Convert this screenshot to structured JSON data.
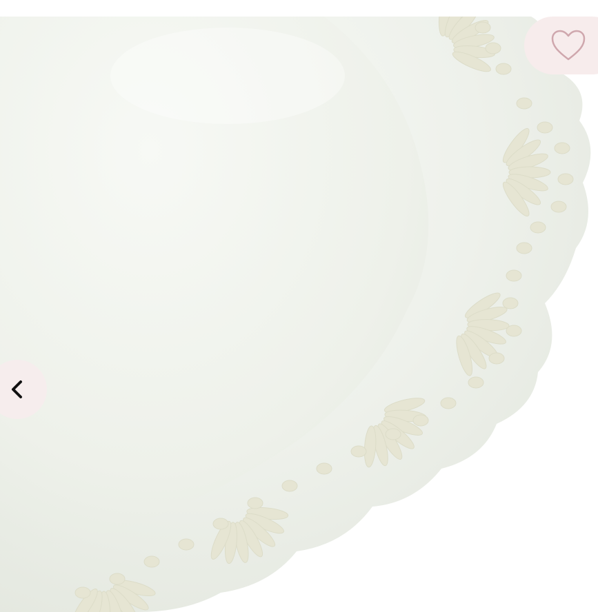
{
  "gallery": {
    "favorite": {
      "icon": "heart-outline-icon",
      "count_label": ""
    },
    "prev_icon": "chevron-left-icon",
    "image": {
      "subject": "white-lace-plate"
    }
  },
  "colors": {
    "plate": "#eff2ec",
    "plate_shade": "#e3e7de",
    "cutout": "#e9e8d8",
    "button_bg": "#f6eded",
    "heart_stroke": "#cfa7ad"
  }
}
